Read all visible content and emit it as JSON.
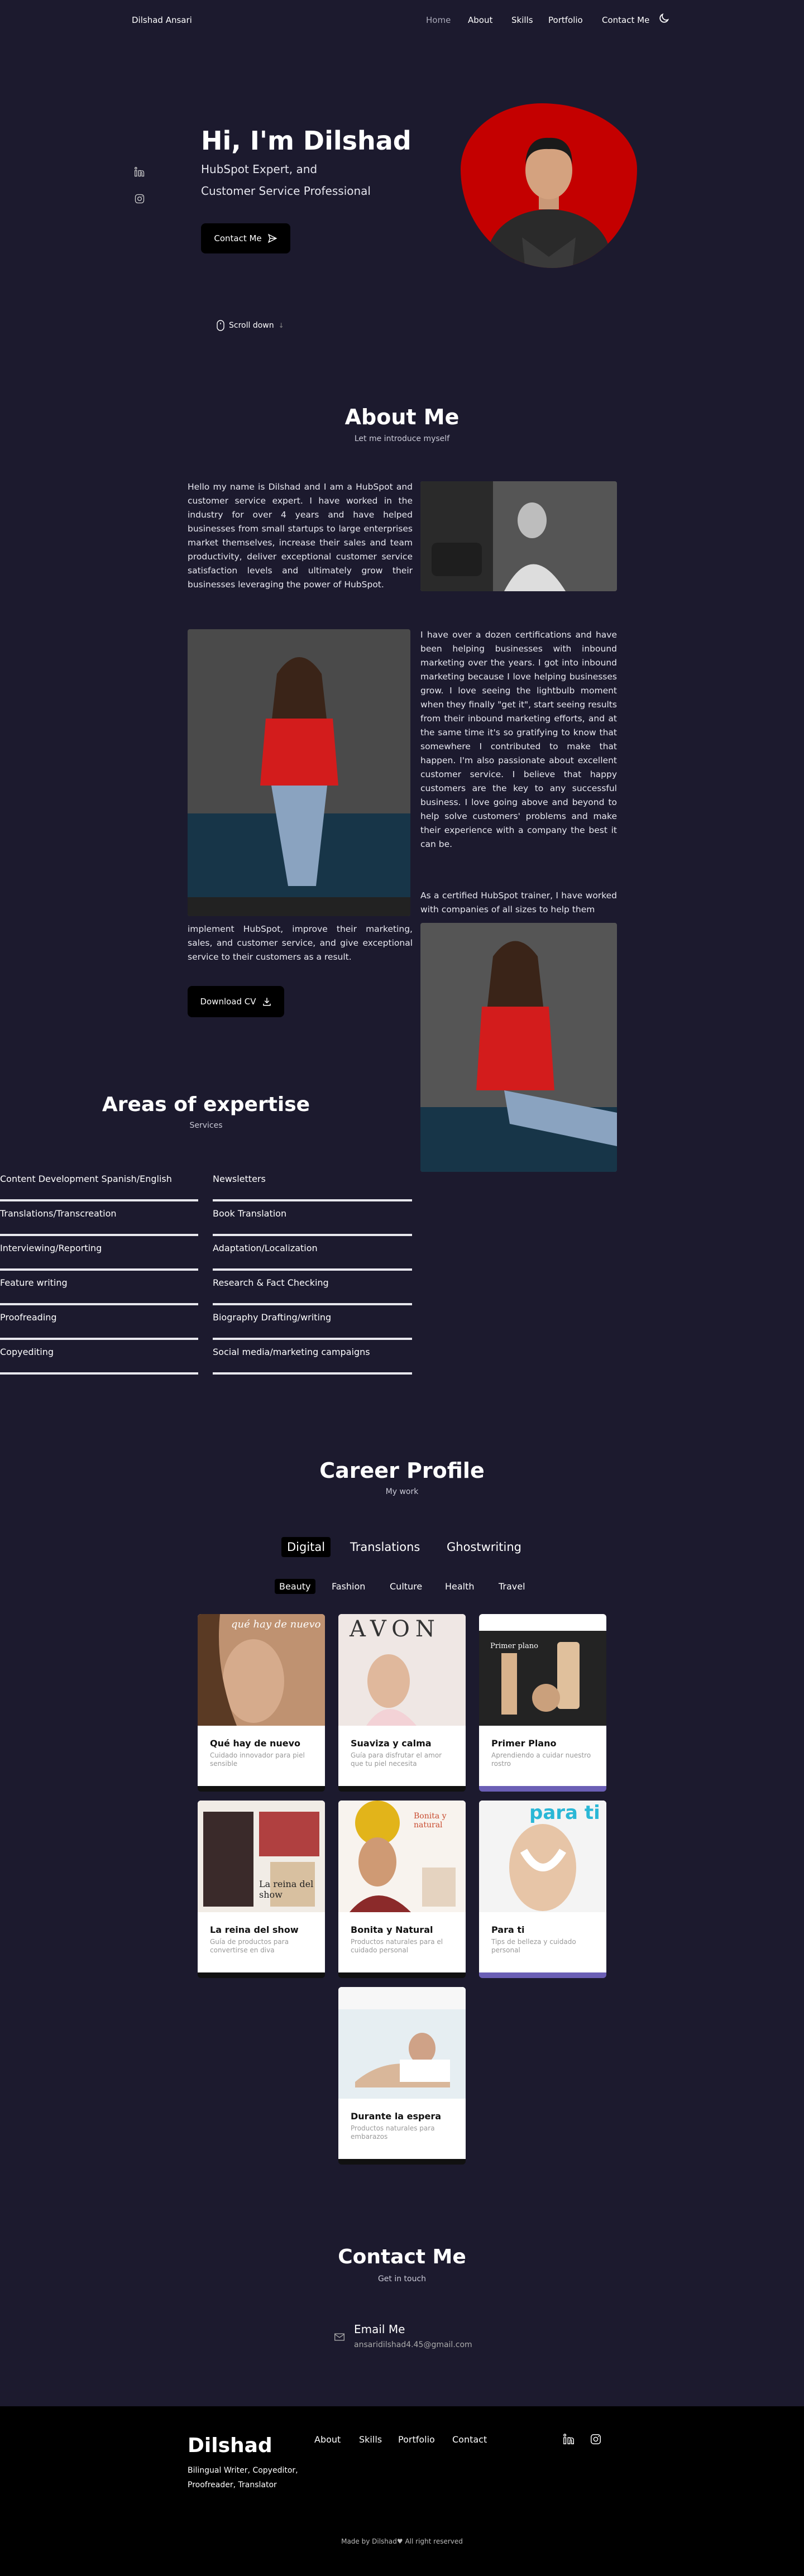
{
  "header": {
    "brand": "Dilshad Ansari",
    "nav": [
      "Home",
      "About",
      "Skills",
      "Portfolio",
      "Contact Me"
    ],
    "theme_icon": "moon-icon"
  },
  "hero": {
    "title": "Hi, I'm Dilshad",
    "subtitle1": "HubSpot Expert, and",
    "subtitle2": "Customer Service Professional",
    "cta": "Contact Me",
    "scroll": "Scroll down",
    "social_icons": [
      "linkedin-icon",
      "instagram-icon"
    ]
  },
  "about": {
    "title": "About Me",
    "subtitle": "Let me introduce myself",
    "p1": "Hello my name is Dilshad and I am a HubSpot and customer service expert. I have worked in the industry for over 4 years and have helped businesses from small startups to large enterprises market themselves, increase their sales and team productivity, deliver exceptional customer service satisfaction levels and ultimately grow their businesses leveraging the power of HubSpot.",
    "p2": "I have over a dozen certifications and have been helping businesses with inbound marketing over the years. I got into inbound marketing because I love helping businesses grow. I love seeing the lightbulb moment when they finally \"get it\", start seeing results from their inbound marketing efforts, and at the same time it's so gratifying to know that somewhere I contributed to make that happen. I'm also passionate about excellent customer service. I believe that happy customers are the key to any successful business. I love going above and beyond to help solve customers' problems and make their experience with a company the best it can be.",
    "p3a": "As a certified HubSpot trainer, I have worked with companies of all sizes to help them",
    "p3b": "implement HubSpot, improve their marketing, sales, and customer service, and give exceptional service to their customers as a result.",
    "download": "Download CV"
  },
  "expertise": {
    "title": "Areas of expertise",
    "subtitle": "Services",
    "left": [
      "Content Development Spanish/English",
      "Translations/Transcreation",
      "Interviewing/Reporting",
      "Feature writing",
      "Proofreading",
      "Copyediting"
    ],
    "right": [
      "Newsletters",
      "Book Translation",
      "Adaptation/Localization",
      "Research & Fact Checking",
      "Biography Drafting/writing",
      "Social media/marketing campaigns"
    ]
  },
  "career": {
    "title": "Career Profile",
    "subtitle": "My work",
    "tabs": [
      "Digital",
      "Translations",
      "Ghostwriting"
    ],
    "subtabs": [
      "Beauty",
      "Fashion",
      "Culture",
      "Health",
      "Travel"
    ],
    "cards": [
      {
        "title": "Qué hay de nuevo",
        "desc": "Cuidado innovador para piel sensible",
        "img_text": "qué hay de nuevo"
      },
      {
        "title": "Suaviza y calma",
        "desc": "Guía para disfrutar el amor que tu piel necesita",
        "img_text": "AVON"
      },
      {
        "title": "Primer Plano",
        "desc": "Aprendiendo a cuidar nuestro rostro",
        "img_text": "Primer plano"
      },
      {
        "title": "La reina del show",
        "desc": "Guía de productos para convertirse en diva",
        "img_text": "La reina del show"
      },
      {
        "title": "Bonita y Natural",
        "desc": "Productos naturales para el cuidado personal",
        "img_text": "Bonita y natural"
      },
      {
        "title": "Para ti",
        "desc": "Tips de belleza y cuidado personal",
        "img_text": "para ti"
      },
      {
        "title": "Durante la espera",
        "desc": "Productos naturales para embarazos",
        "img_text": ""
      }
    ]
  },
  "contact": {
    "title": "Contact Me",
    "subtitle": "Get in touch",
    "email_label": "Email Me",
    "email": "ansaridilshad4.45@gmail.com"
  },
  "footer": {
    "name": "Dilshad",
    "tag1": "Bilingual Writer, Copyeditor,",
    "tag2": "Proofreader, Translator",
    "links": [
      "About",
      "Skills",
      "Portfolio",
      "Contact"
    ],
    "credit": "Made by Dilshad♥ All right reserved"
  },
  "colors": {
    "background": "#1c1a2e",
    "accent": "#6b5fb5",
    "blob": "#c40000"
  }
}
